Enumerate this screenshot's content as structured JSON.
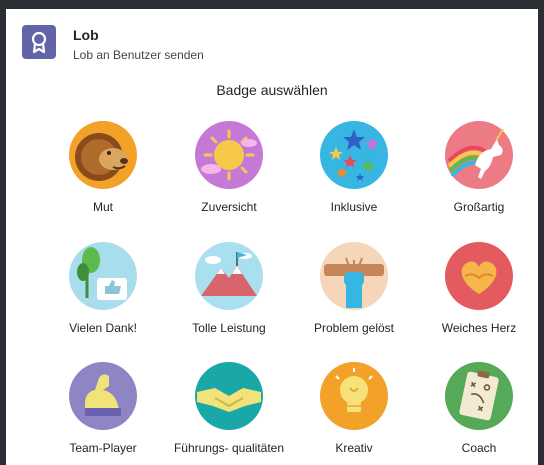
{
  "header": {
    "title": "Lob",
    "subtitle": "Lob an Benutzer senden",
    "icon": "award-ribbon-icon",
    "icon_color": "#6264a7"
  },
  "section_title": "Badge auswählen",
  "badges": [
    {
      "label": "Mut",
      "icon": "lion-icon",
      "color": "#f2a229"
    },
    {
      "label": "Zuversicht",
      "icon": "sun-icon",
      "color": "#c579d6"
    },
    {
      "label": "Inklusive",
      "icon": "stars-icon",
      "color": "#37b6e3"
    },
    {
      "label": "Großartig",
      "icon": "unicorn-icon",
      "color": "#ed7b86"
    },
    {
      "label": "Vielen Dank!",
      "icon": "thumbs-up-plant-icon",
      "color": "#a8ddec"
    },
    {
      "label": "Tolle Leistung",
      "icon": "mountain-flag-icon",
      "color": "#a9e0ef"
    },
    {
      "label": "Problem gelöst",
      "icon": "raised-fist-icon",
      "color": "#f6d6b8"
    },
    {
      "label": "Weiches Herz",
      "icon": "heart-hands-icon",
      "color": "#e35a5f"
    },
    {
      "label": "Team-Player",
      "icon": "flexed-arm-icon",
      "color": "#8e86c4"
    },
    {
      "label": "Führungs- qualitäten",
      "icon": "handshake-icon",
      "color": "#1aa7a7"
    },
    {
      "label": "Kreativ",
      "icon": "light-bulb-icon",
      "color": "#f2a229"
    },
    {
      "label": "Coach",
      "icon": "clipboard-icon",
      "color": "#56a956"
    }
  ]
}
